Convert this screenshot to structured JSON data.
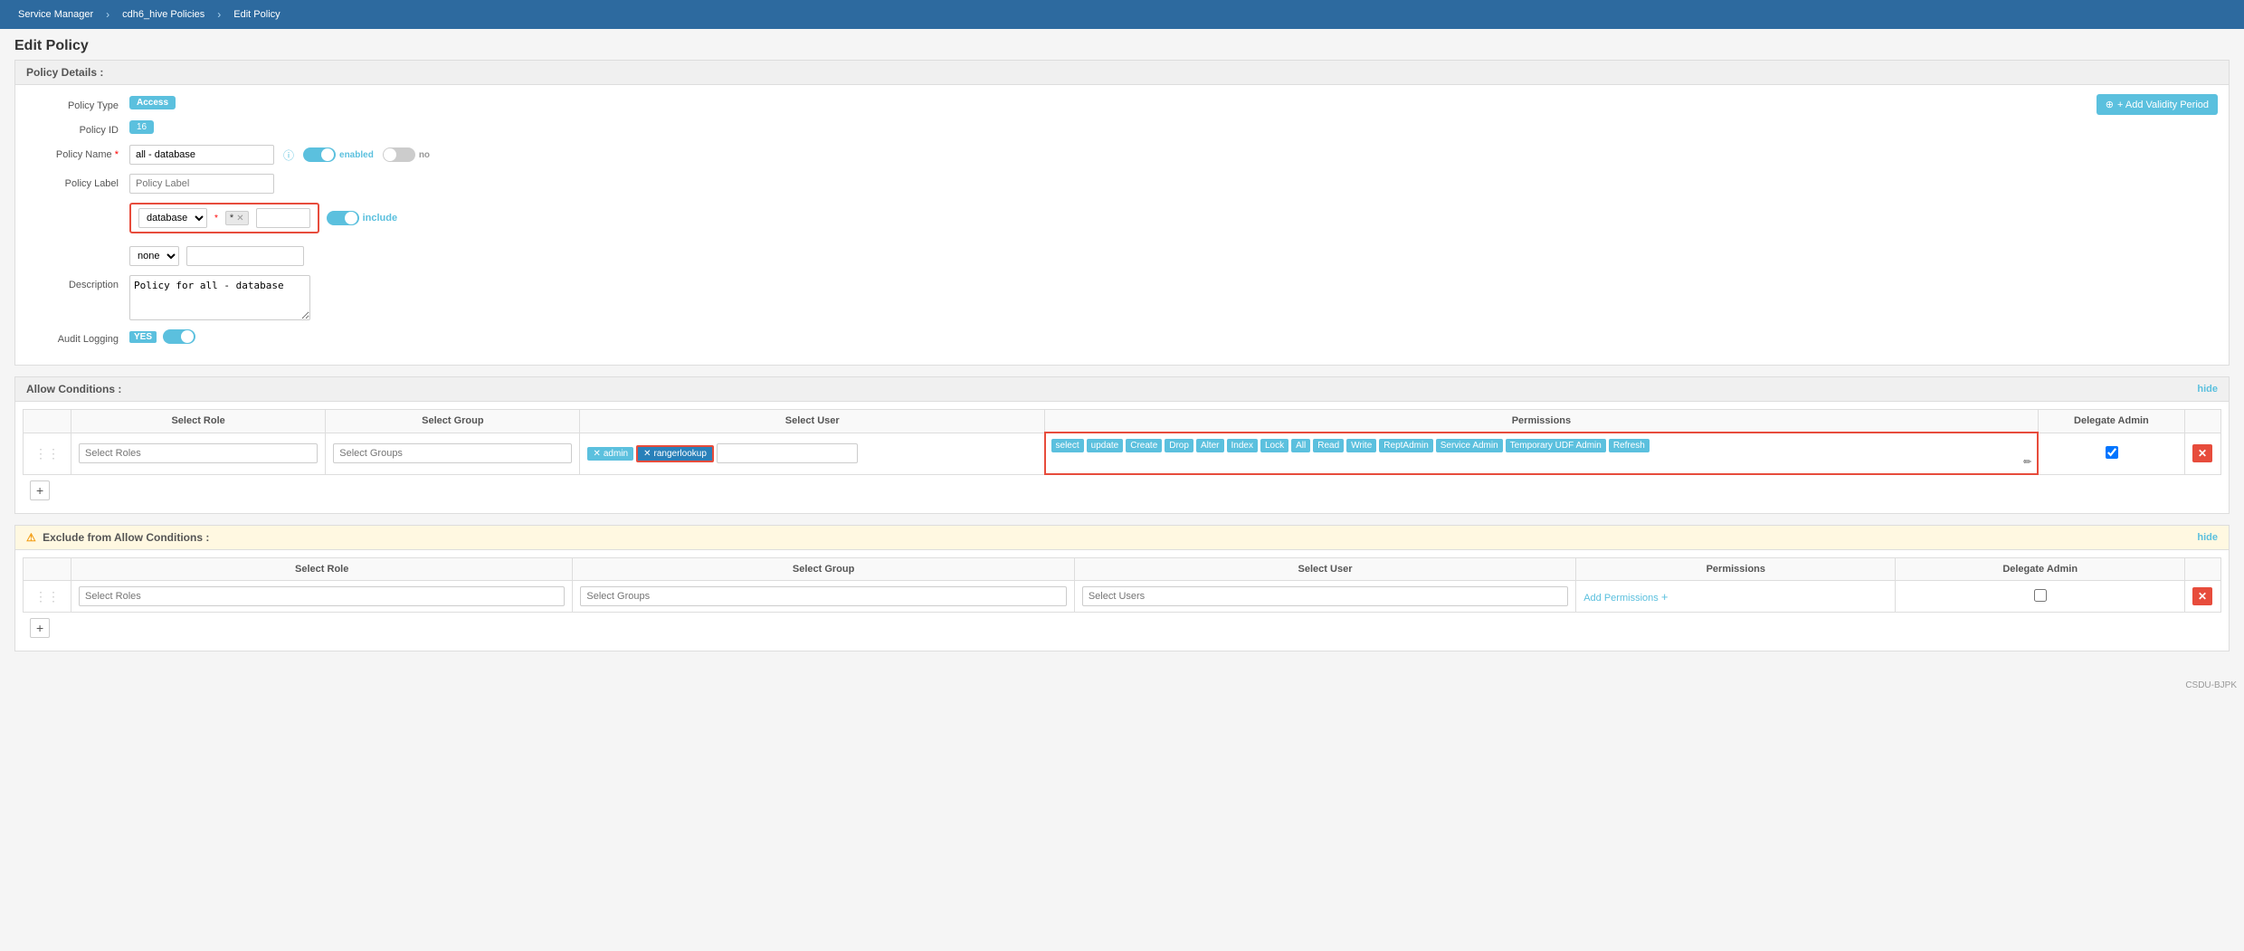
{
  "breadcrumb": {
    "items": [
      {
        "label": "Service Manager"
      },
      {
        "label": "cdh6_hive Policies"
      },
      {
        "label": "Edit Policy"
      }
    ]
  },
  "page": {
    "title": "Edit Policy"
  },
  "policy_details": {
    "section_label": "Policy Details :",
    "policy_type_label": "Policy Type",
    "policy_type_value": "Access",
    "add_validity_label": "+ Add Validity Period",
    "policy_id_label": "Policy ID",
    "policy_id_value": "16",
    "policy_name_label": "Policy Name",
    "policy_name_value": "all - database",
    "enabled_label": "enabled",
    "no_label": "no",
    "policy_label_label": "Policy Label",
    "policy_label_placeholder": "Policy Label",
    "database_label": "database",
    "database_tag": "*",
    "include_label": "include",
    "none_label": "none",
    "description_label": "Description",
    "description_value": "Policy for all - database",
    "audit_logging_label": "Audit Logging",
    "yes_label": "YES"
  },
  "allow_conditions": {
    "section_label": "Allow Conditions :",
    "hide_label": "hide",
    "table_headers": {
      "select_role": "Select Role",
      "select_group": "Select Group",
      "select_user": "Select User",
      "permissions": "Permissions",
      "delegate_admin": "Delegate Admin"
    },
    "rows": [
      {
        "role_placeholder": "Select Roles",
        "group_placeholder": "Select Groups",
        "users": [
          "admin",
          "rangerlookup"
        ],
        "rangerlookup_highlighted": true,
        "permissions": [
          "select",
          "update",
          "Create",
          "Drop",
          "Alter",
          "Index",
          "Lock",
          "All",
          "Read",
          "Write",
          "ReptAdmin",
          "Service Admin",
          "Temporary UDF Admin",
          "Refresh"
        ],
        "delegate_admin": true
      }
    ],
    "add_row_label": "+"
  },
  "exclude_conditions": {
    "section_label": "Exclude from Allow Conditions :",
    "hide_label": "hide",
    "table_headers": {
      "select_role": "Select Role",
      "select_group": "Select Group",
      "select_user": "Select User",
      "permissions": "Permissions",
      "delegate_admin": "Delegate Admin"
    },
    "rows": [
      {
        "role_placeholder": "Select Roles",
        "group_placeholder": "Select Groups",
        "user_placeholder": "Select Users",
        "permissions_link": "Add Permissions",
        "delegate_admin": false
      }
    ],
    "add_row_label": "+"
  },
  "footer": {
    "text": "CSDU-BJPK"
  }
}
